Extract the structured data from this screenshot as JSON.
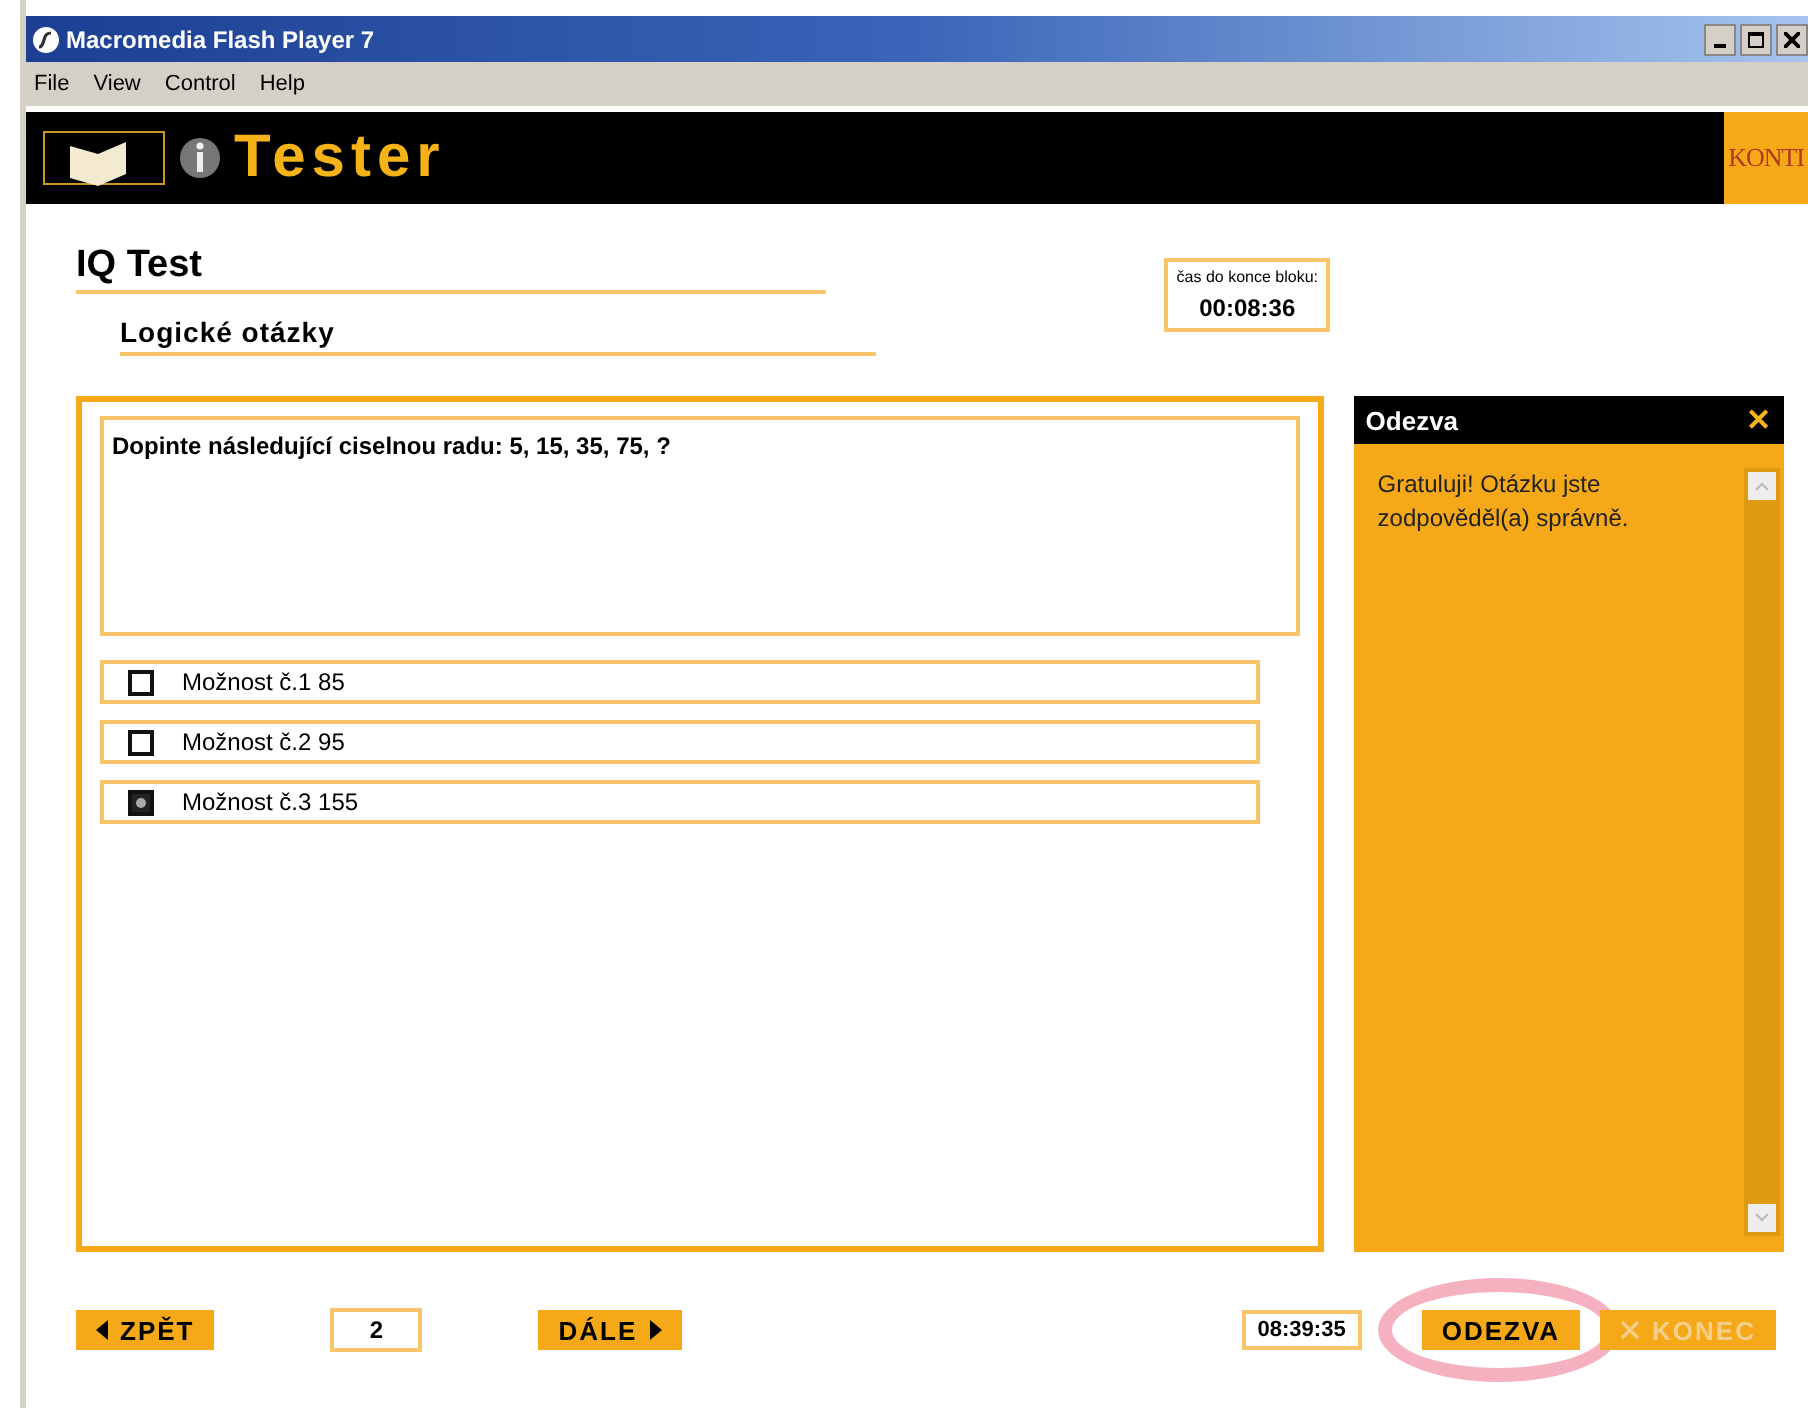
{
  "window": {
    "title": "Macromedia Flash Player 7"
  },
  "menu": [
    "File",
    "View",
    "Control",
    "Help"
  ],
  "banner": {
    "title": "Tester",
    "logo": "KONTI"
  },
  "heading": "IQ Test",
  "subheading": "Logické otázky",
  "timer": {
    "label": "čas do konce bloku:",
    "value": "00:08:36"
  },
  "question": "Dopinte následující ciselnou radu: 5, 15, 35, 75, ?",
  "options": [
    {
      "label": "Možnost č.1 85",
      "selected": false
    },
    {
      "label": "Možnost č.2 95",
      "selected": false
    },
    {
      "label": "Možnost č.3 155",
      "selected": true
    }
  ],
  "feedback": {
    "title": "Odezva",
    "close": "✕",
    "text": "Gratuluji! Otázku jste zodpověděl(a) správně."
  },
  "footer": {
    "back": "ZPĚT",
    "page": "2",
    "next": "DÁLE",
    "clock": "08:39:35",
    "buttons": [
      {
        "label": "ODEZVA",
        "disabled": false,
        "highlighted": true
      },
      {
        "label": "KONEC",
        "disabled": true,
        "highlighted": false
      }
    ]
  }
}
